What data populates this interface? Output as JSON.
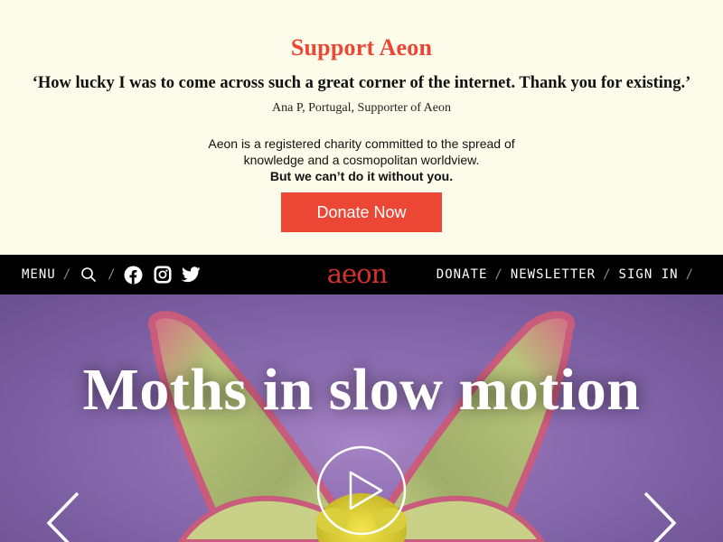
{
  "support": {
    "title": "Support Aeon",
    "quote": "‘How lucky I was to come across such a great corner of the internet. Thank you for existing.’",
    "attribution": "Ana P, Portugal, Supporter of Aeon",
    "body_line1": "Aeon is a registered charity committed to the spread of",
    "body_line2": "knowledge and a cosmopolitan worldview.",
    "body_bold": "But we can’t do it without you.",
    "donate_label": "Donate Now"
  },
  "nav": {
    "menu_label": "MENU",
    "separator": "/",
    "logo_text": "aeon",
    "donate_label": "DONATE",
    "newsletter_label": "NEWSLETTER",
    "signin_label": "SIGN IN",
    "icons": [
      "search-icon",
      "facebook-icon",
      "instagram-icon",
      "twitter-icon"
    ]
  },
  "hero": {
    "title": "Moths in slow motion",
    "icons": [
      "play-icon",
      "chevron-left-icon",
      "chevron-right-icon"
    ]
  },
  "colors": {
    "accent": "#ec4634",
    "logo": "#d2322d",
    "banner_bg": "#fdfbe9",
    "nav_bg": "#000000",
    "hero_bg": "#8a6bb0"
  }
}
